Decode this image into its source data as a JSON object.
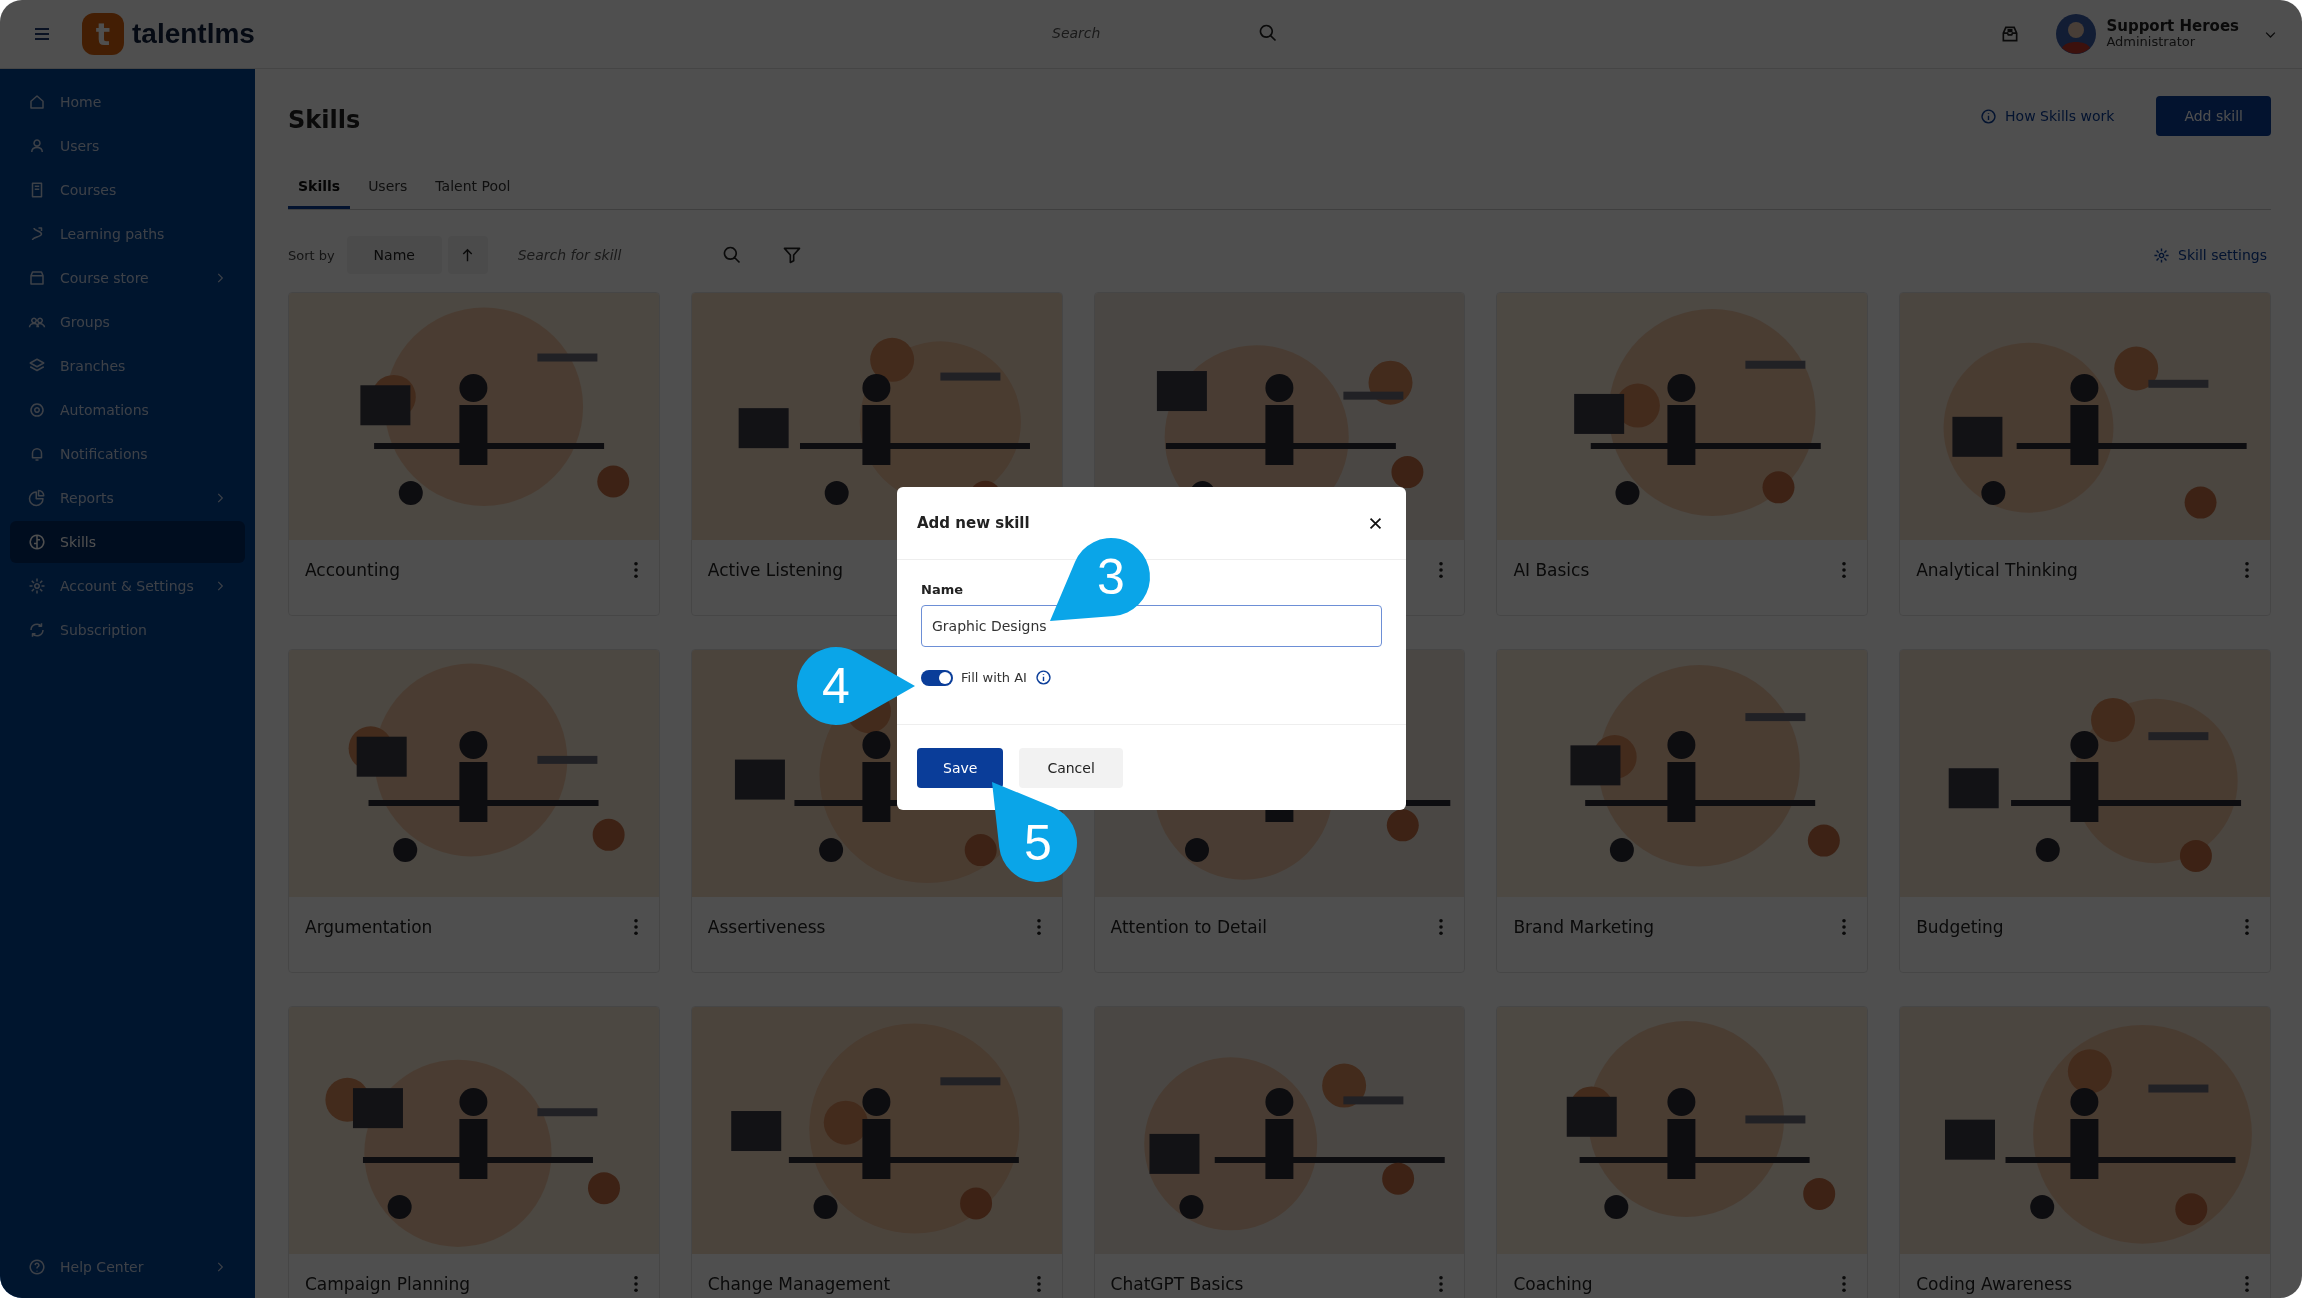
{
  "app": {
    "logo": {
      "mark": "t",
      "name": "talentlms"
    },
    "search": {
      "placeholder": "Search"
    },
    "user": {
      "name": "Support Heroes",
      "role": "Administrator"
    }
  },
  "sidebar": {
    "items": [
      {
        "label": "Home",
        "expandable": false,
        "selected": false
      },
      {
        "label": "Users",
        "expandable": false,
        "selected": false
      },
      {
        "label": "Courses",
        "expandable": false,
        "selected": false
      },
      {
        "label": "Learning paths",
        "expandable": false,
        "selected": false
      },
      {
        "label": "Course store",
        "expandable": true,
        "selected": false
      },
      {
        "label": "Groups",
        "expandable": false,
        "selected": false
      },
      {
        "label": "Branches",
        "expandable": false,
        "selected": false
      },
      {
        "label": "Automations",
        "expandable": false,
        "selected": false
      },
      {
        "label": "Notifications",
        "expandable": false,
        "selected": false
      },
      {
        "label": "Reports",
        "expandable": true,
        "selected": false
      },
      {
        "label": "Skills",
        "expandable": false,
        "selected": true
      },
      {
        "label": "Account & Settings",
        "expandable": true,
        "selected": false
      },
      {
        "label": "Subscription",
        "expandable": false,
        "selected": false
      }
    ],
    "footer": {
      "label": "Help Center",
      "expandable": true
    }
  },
  "page": {
    "title": "Skills",
    "help_link": "How Skills work",
    "primary_button": "Add skill",
    "tabs": [
      {
        "label": "Skills",
        "selected": true
      },
      {
        "label": "Users",
        "selected": false
      },
      {
        "label": "Talent Pool",
        "selected": false
      }
    ],
    "toolbar": {
      "sort_label": "Sort by",
      "sort_field": "Name",
      "search_placeholder": "Search for skill",
      "settings_link": "Skill settings"
    }
  },
  "skills": [
    {
      "kind": "picture",
      "name": "Accounting",
      "menu": true
    },
    {
      "kind": "picture",
      "name": "Active Listening",
      "menu": false
    },
    {
      "kind": "picture",
      "menu": true
    },
    {
      "kind": "picture",
      "name": "AI Basics",
      "menu": true
    },
    {
      "kind": "picture",
      "name": "Analytical Thinking",
      "menu": true
    },
    {
      "kind": "picture",
      "name": "Argumentation",
      "menu": true
    },
    {
      "kind": "picture",
      "name": "Assertiveness",
      "menu": true
    },
    {
      "kind": "picture",
      "name": "Attention to Detail",
      "menu": true
    },
    {
      "kind": "picture",
      "name": "Brand Marketing",
      "menu": true
    },
    {
      "kind": "picture",
      "name": "Budgeting",
      "menu": true
    },
    {
      "kind": "picture",
      "name": "Campaign Planning",
      "menu": true
    },
    {
      "kind": "picture",
      "name": "Change Management",
      "menu": true
    },
    {
      "kind": "picture",
      "name": "ChatGPT Basics",
      "menu": true
    },
    {
      "kind": "picture",
      "name": "Coaching",
      "menu": true
    },
    {
      "kind": "picture",
      "name": "Coding Awareness",
      "menu": true
    }
  ],
  "dialog": {
    "title": "Add new skill",
    "field_label": "Name",
    "field_value": "Graphic Designs",
    "toggle": {
      "label": "Fill with AI",
      "on": true
    },
    "buttons": [
      {
        "label": "Save",
        "kind": "primary"
      },
      {
        "label": "Cancel",
        "kind": "secondary"
      }
    ]
  },
  "callouts": [
    {
      "label": "3"
    },
    {
      "label": "4"
    },
    {
      "label": "5"
    }
  ]
}
